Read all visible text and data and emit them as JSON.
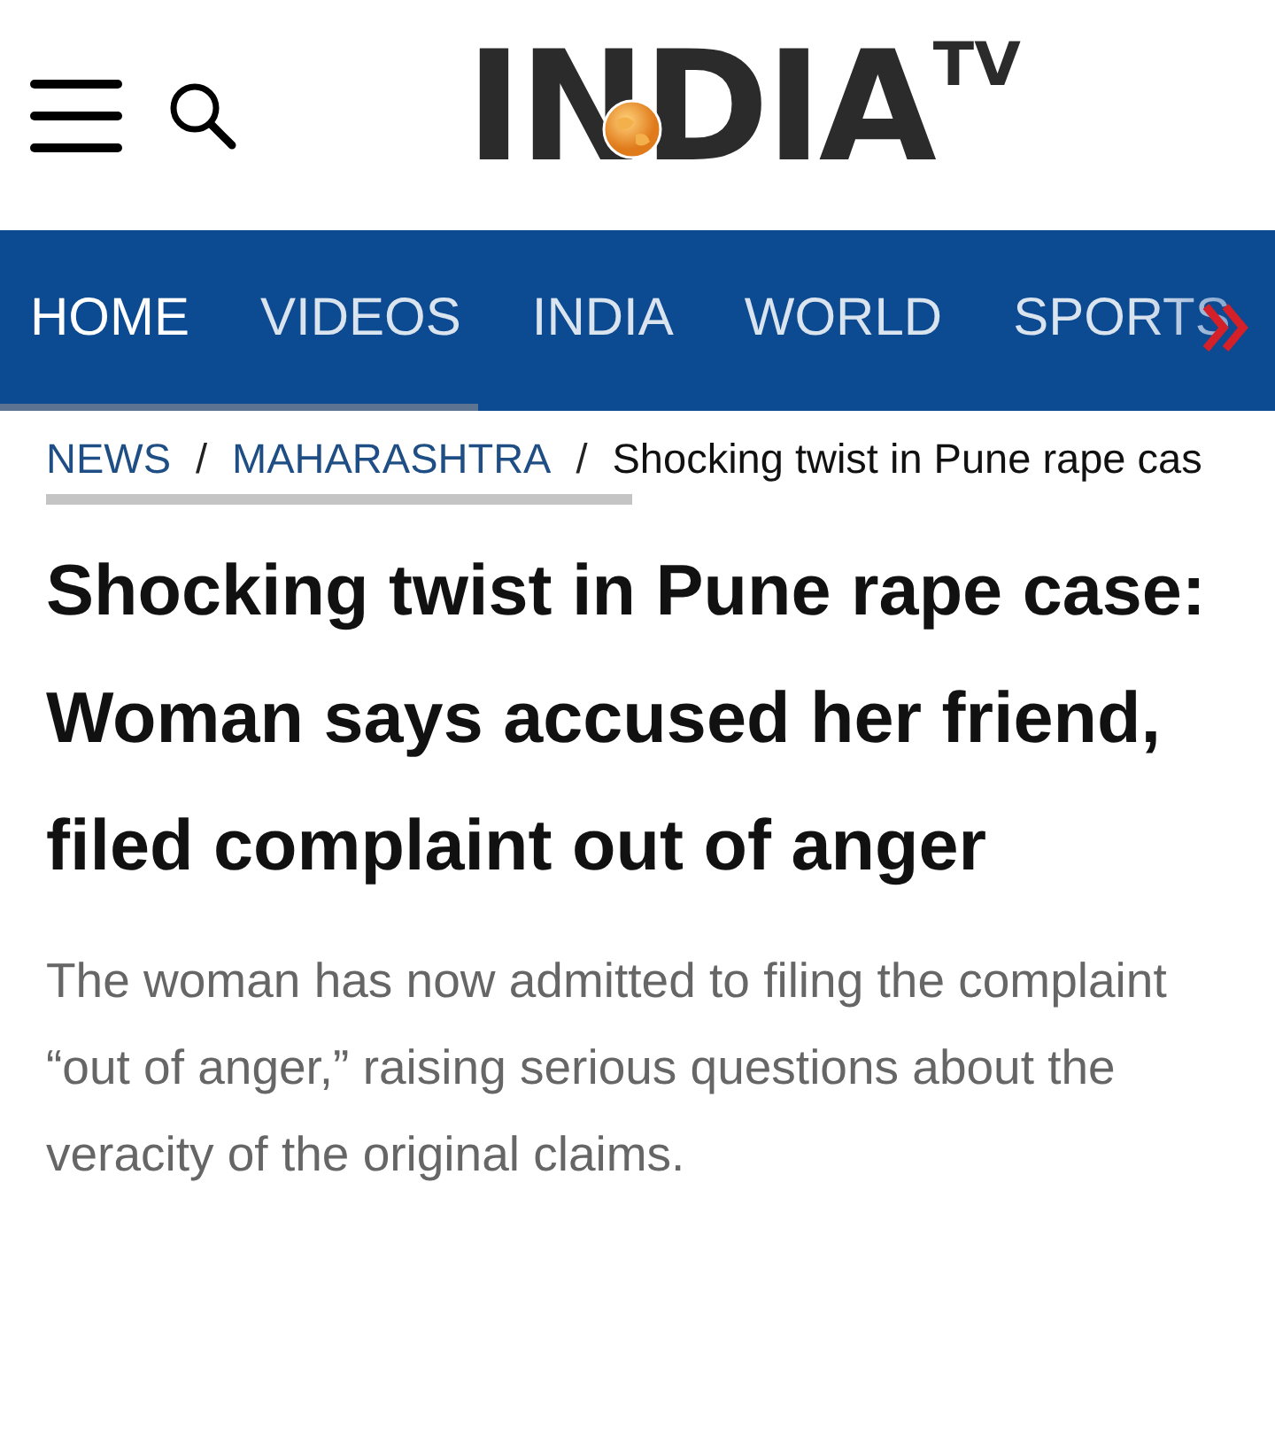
{
  "header": {
    "logo": {
      "main": "INDIA",
      "sup": "TV"
    }
  },
  "nav": {
    "items": [
      {
        "label": "HOME",
        "selected": true
      },
      {
        "label": "VIDEOS",
        "selected": false
      },
      {
        "label": "INDIA",
        "selected": false
      },
      {
        "label": "WORLD",
        "selected": false
      },
      {
        "label": "SPORTS",
        "selected": false
      }
    ]
  },
  "breadcrumb": [
    {
      "label": "NEWS",
      "kind": "link"
    },
    {
      "label": "/",
      "kind": "separator"
    },
    {
      "label": "MAHARASHTRA",
      "kind": "link"
    },
    {
      "label": "/",
      "kind": "separator"
    },
    {
      "label": "Shocking twist in Pune rape cas",
      "kind": "current"
    }
  ],
  "article": {
    "headline": "Shocking twist in Pune rape case: Woman says accused her friend, filed complaint out of anger",
    "summary": "The woman has now admitted to filing the complaint “out of anger,” raising serious questions about the veracity of the original claims."
  }
}
